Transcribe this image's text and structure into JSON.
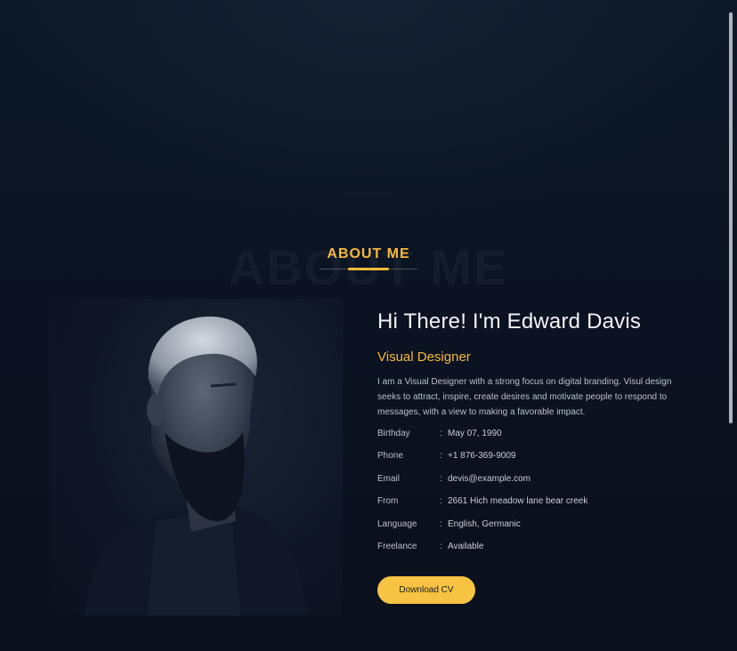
{
  "section": {
    "background_word": "ABOUT ME",
    "title": "ABOUT ME"
  },
  "profile": {
    "greeting": "Hi There! I'm Edward Davis",
    "role": "Visual Designer",
    "bio": "I am a Visual Designer with a strong focus on digital branding. Visul design seeks to attract, inspire, create desires and motivate people to respond to messages, with a view to making a favorable impact."
  },
  "details": [
    {
      "label": "Birthday",
      "separator": ":",
      "value": "May 07, 1990"
    },
    {
      "label": "Phone",
      "separator": ":",
      "value": "+1 876-369-9009"
    },
    {
      "label": "Email",
      "separator": ":",
      "value": "devis@example.com"
    },
    {
      "label": "From",
      "separator": ":",
      "value": "2661 Hich meadow lane bear creek"
    },
    {
      "label": "Language",
      "separator": ":",
      "value": "English, Germanic"
    },
    {
      "label": "Freelance",
      "separator": ":",
      "value": "Available"
    }
  ],
  "cta": {
    "label": "Download CV"
  },
  "colors": {
    "accent": "#f6b93b",
    "button": "#f6c343",
    "background": "#0b1120"
  }
}
